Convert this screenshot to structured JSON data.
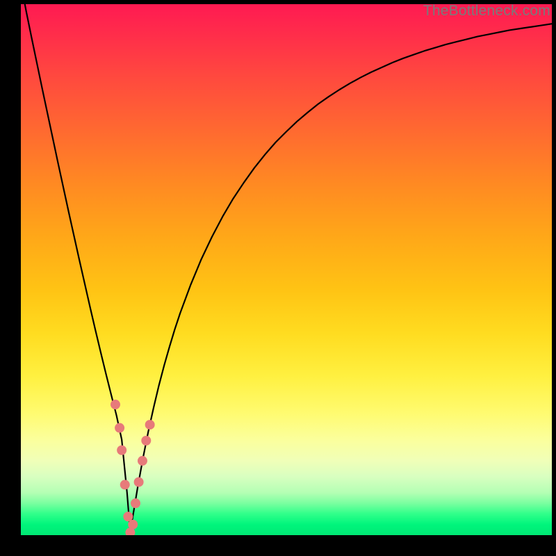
{
  "watermark": {
    "text": "TheBottleneck.com"
  },
  "colors": {
    "frame": "#000000",
    "curve": "#000000",
    "marker_fill": "#e77a7a",
    "marker_stroke": "#c94f4f"
  },
  "chart_data": {
    "type": "line",
    "title": "",
    "xlabel": "",
    "ylabel": "",
    "xlim": [
      0,
      100
    ],
    "ylim": [
      0,
      100
    ],
    "grid": false,
    "legend": false,
    "annotations": [],
    "x": [
      0,
      1,
      2,
      3,
      4,
      5,
      6,
      7,
      8,
      9,
      10,
      11,
      12,
      13,
      14,
      15,
      16,
      17,
      18,
      19,
      20,
      20.6,
      21,
      22,
      23,
      24,
      25,
      26,
      27,
      28,
      29,
      30,
      32,
      34,
      36,
      38,
      40,
      42,
      44,
      46,
      48,
      50,
      52,
      54,
      56,
      58,
      60,
      62,
      64,
      66,
      68,
      70,
      72,
      74,
      76,
      78,
      80,
      82,
      84,
      86,
      88,
      90,
      92,
      94,
      96,
      98,
      100
    ],
    "y": [
      104,
      98.7,
      93.8,
      89.0,
      84.2,
      79.5,
      74.8,
      70.1,
      65.5,
      60.9,
      56.4,
      51.9,
      47.5,
      43.1,
      38.8,
      34.6,
      30.5,
      26.5,
      22.6,
      18.0,
      8.0,
      0.5,
      3.0,
      9.0,
      14.5,
      19.5,
      24.0,
      28.2,
      32.0,
      35.5,
      38.8,
      41.8,
      47.2,
      52.0,
      56.2,
      60.0,
      63.4,
      66.4,
      69.2,
      71.7,
      74.0,
      76.0,
      77.9,
      79.6,
      81.2,
      82.6,
      83.9,
      85.1,
      86.2,
      87.2,
      88.1,
      89.0,
      89.8,
      90.5,
      91.2,
      91.8,
      92.4,
      92.9,
      93.4,
      93.9,
      94.3,
      94.7,
      95.1,
      95.4,
      95.7,
      96.0,
      96.3
    ],
    "markers": {
      "x": [
        17.8,
        18.6,
        19.0,
        19.6,
        20.2,
        20.6,
        21.1,
        21.6,
        22.2,
        22.9,
        23.6,
        24.3
      ],
      "y": [
        24.6,
        20.2,
        16.0,
        9.5,
        3.5,
        0.5,
        2.0,
        6.0,
        10.0,
        14.0,
        17.8,
        20.8
      ]
    }
  }
}
